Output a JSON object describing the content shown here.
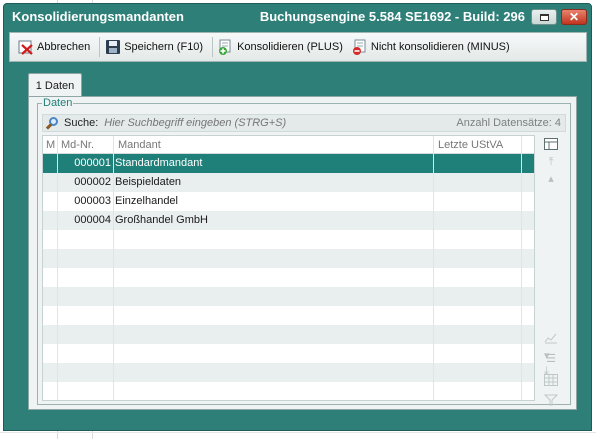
{
  "window": {
    "title": "Konsolidierungsmandanten",
    "build_info": "Buchungsengine 5.584 SE1692 - Build: 296"
  },
  "toolbar": {
    "cancel_label": "Abbrechen",
    "save_label": "Speichern (F10)",
    "consolidate_label": "Konsolidieren (PLUS)",
    "unconsolidate_label": "Nicht konsolidieren (MINUS)"
  },
  "tabs": [
    {
      "label": "1 Daten"
    }
  ],
  "group": {
    "legend": "Daten"
  },
  "search": {
    "label": "Suche:",
    "placeholder": "Hier Suchbegriff eingeben (STRG+S)",
    "record_count": "Anzahl Datensätze: 4"
  },
  "grid": {
    "columns": [
      "M",
      "Md-Nr.",
      "Mandant",
      "Letzte UStVA"
    ],
    "rows": [
      {
        "md_nr": "000001",
        "mandant": "Standardmandant",
        "selected": true
      },
      {
        "md_nr": "000002",
        "mandant": "Beispieldaten"
      },
      {
        "md_nr": "000003",
        "mandant": "Einzelhandel"
      },
      {
        "md_nr": "000004",
        "mandant": "Großhandel GmbH"
      }
    ]
  },
  "icons": {
    "cancel": "cancel-icon",
    "save": "floppy-disk-icon",
    "consolidate": "consolidate-plus-icon",
    "unconsolidate": "consolidate-minus-icon",
    "search": "magnifier-icon"
  },
  "colors": {
    "window_frame": "#2d7f78",
    "selected_row": "#1f807a",
    "legend_text": "#1f7f78",
    "close_button": "#c1341f"
  }
}
